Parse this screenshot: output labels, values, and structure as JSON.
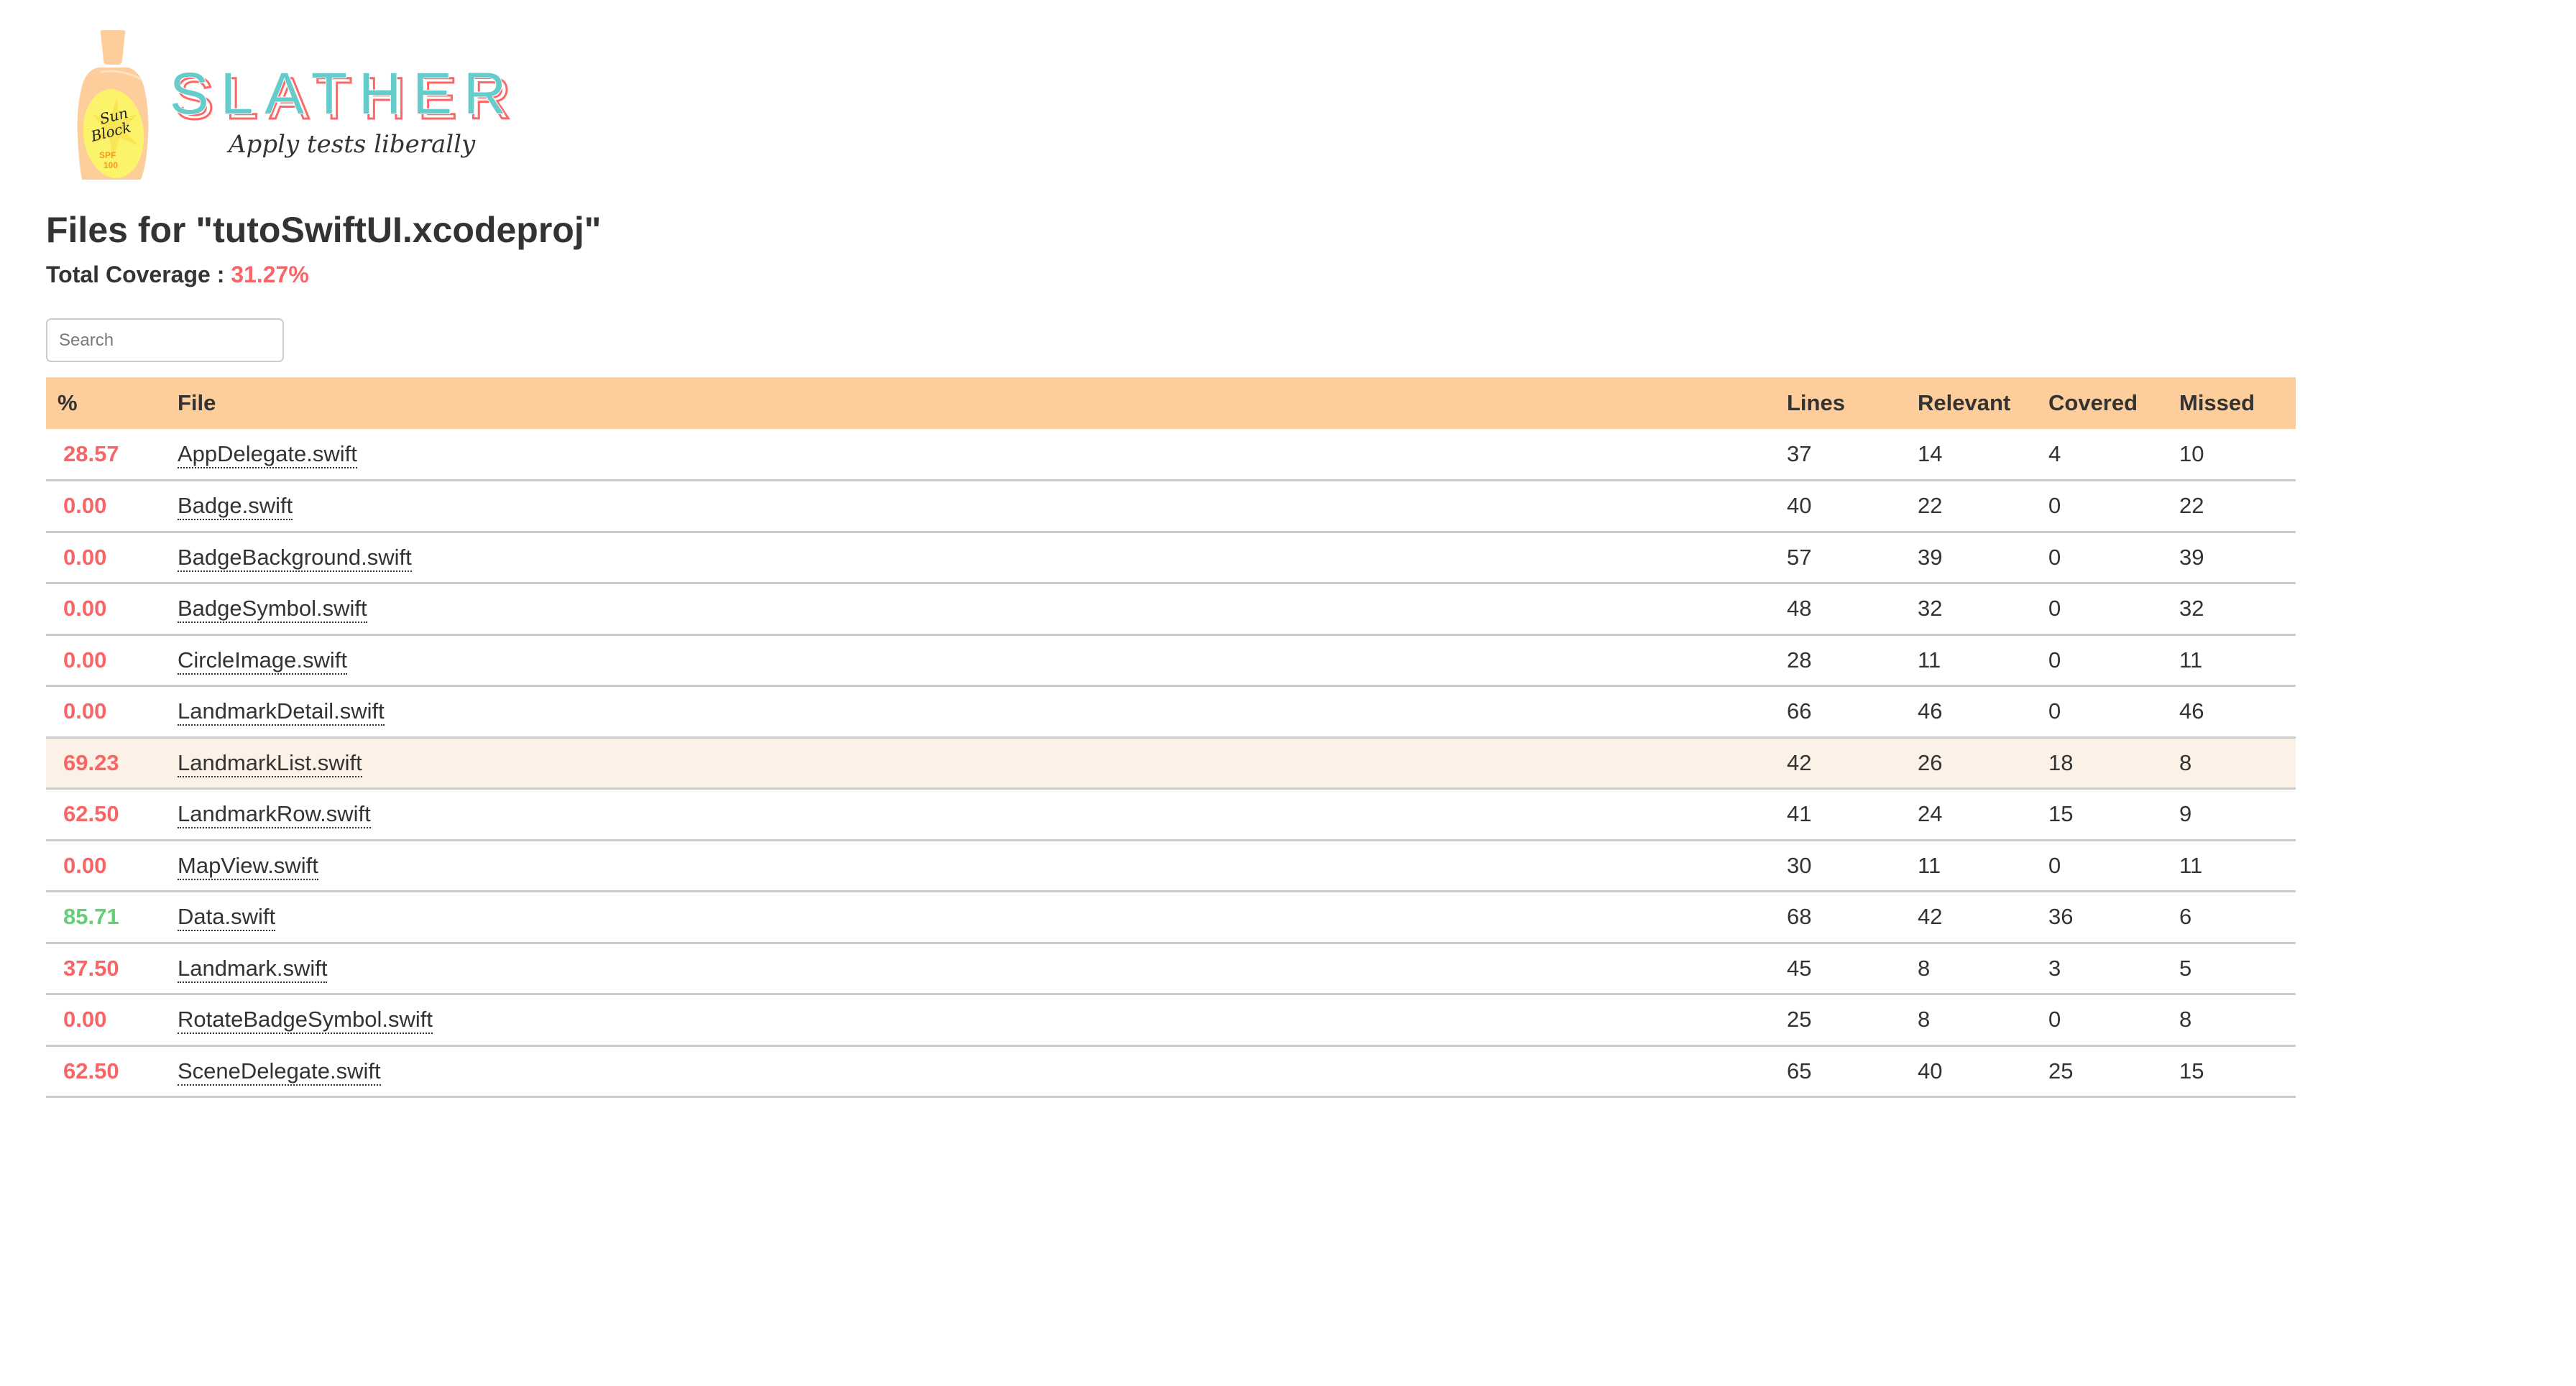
{
  "logo": {
    "wordmark": "SLATHER",
    "tagline": "Apply tests liberally",
    "bottle_label_line1": "Sun",
    "bottle_label_line2": "Block",
    "bottle_spf_line1": "SPF",
    "bottle_spf_line2": "100"
  },
  "header": {
    "title": "Files for \"tutoSwiftUI.xcodeproj\"",
    "total_coverage_label": "Total Coverage : ",
    "total_coverage_value": "31.27%"
  },
  "search": {
    "placeholder": "Search",
    "value": ""
  },
  "colors": {
    "header_bg": "#fdcd9b",
    "low_coverage": "#f96566",
    "high_coverage": "#62cf75",
    "highlight_row": "#fcf1e6",
    "logo_teal": "#65cbcb",
    "logo_coral": "#ff6666"
  },
  "table": {
    "columns": [
      "%",
      "File",
      "Lines",
      "Relevant",
      "Covered",
      "Missed"
    ],
    "rows": [
      {
        "pct": "28.57",
        "file": "AppDelegate.swift",
        "lines": "37",
        "relevant": "14",
        "covered": "4",
        "missed": "10",
        "level": "low",
        "highlighted": false
      },
      {
        "pct": "0.00",
        "file": "Badge.swift",
        "lines": "40",
        "relevant": "22",
        "covered": "0",
        "missed": "22",
        "level": "low",
        "highlighted": false
      },
      {
        "pct": "0.00",
        "file": "BadgeBackground.swift",
        "lines": "57",
        "relevant": "39",
        "covered": "0",
        "missed": "39",
        "level": "low",
        "highlighted": false
      },
      {
        "pct": "0.00",
        "file": "BadgeSymbol.swift",
        "lines": "48",
        "relevant": "32",
        "covered": "0",
        "missed": "32",
        "level": "low",
        "highlighted": false
      },
      {
        "pct": "0.00",
        "file": "CircleImage.swift",
        "lines": "28",
        "relevant": "11",
        "covered": "0",
        "missed": "11",
        "level": "low",
        "highlighted": false
      },
      {
        "pct": "0.00",
        "file": "LandmarkDetail.swift",
        "lines": "66",
        "relevant": "46",
        "covered": "0",
        "missed": "46",
        "level": "low",
        "highlighted": false
      },
      {
        "pct": "69.23",
        "file": "LandmarkList.swift",
        "lines": "42",
        "relevant": "26",
        "covered": "18",
        "missed": "8",
        "level": "low",
        "highlighted": true
      },
      {
        "pct": "62.50",
        "file": "LandmarkRow.swift",
        "lines": "41",
        "relevant": "24",
        "covered": "15",
        "missed": "9",
        "level": "low",
        "highlighted": false
      },
      {
        "pct": "0.00",
        "file": "MapView.swift",
        "lines": "30",
        "relevant": "11",
        "covered": "0",
        "missed": "11",
        "level": "low",
        "highlighted": false
      },
      {
        "pct": "85.71",
        "file": "Data.swift",
        "lines": "68",
        "relevant": "42",
        "covered": "36",
        "missed": "6",
        "level": "high",
        "highlighted": false
      },
      {
        "pct": "37.50",
        "file": "Landmark.swift",
        "lines": "45",
        "relevant": "8",
        "covered": "3",
        "missed": "5",
        "level": "low",
        "highlighted": false
      },
      {
        "pct": "0.00",
        "file": "RotateBadgeSymbol.swift",
        "lines": "25",
        "relevant": "8",
        "covered": "0",
        "missed": "8",
        "level": "low",
        "highlighted": false
      },
      {
        "pct": "62.50",
        "file": "SceneDelegate.swift",
        "lines": "65",
        "relevant": "40",
        "covered": "25",
        "missed": "15",
        "level": "low",
        "highlighted": false
      }
    ]
  }
}
